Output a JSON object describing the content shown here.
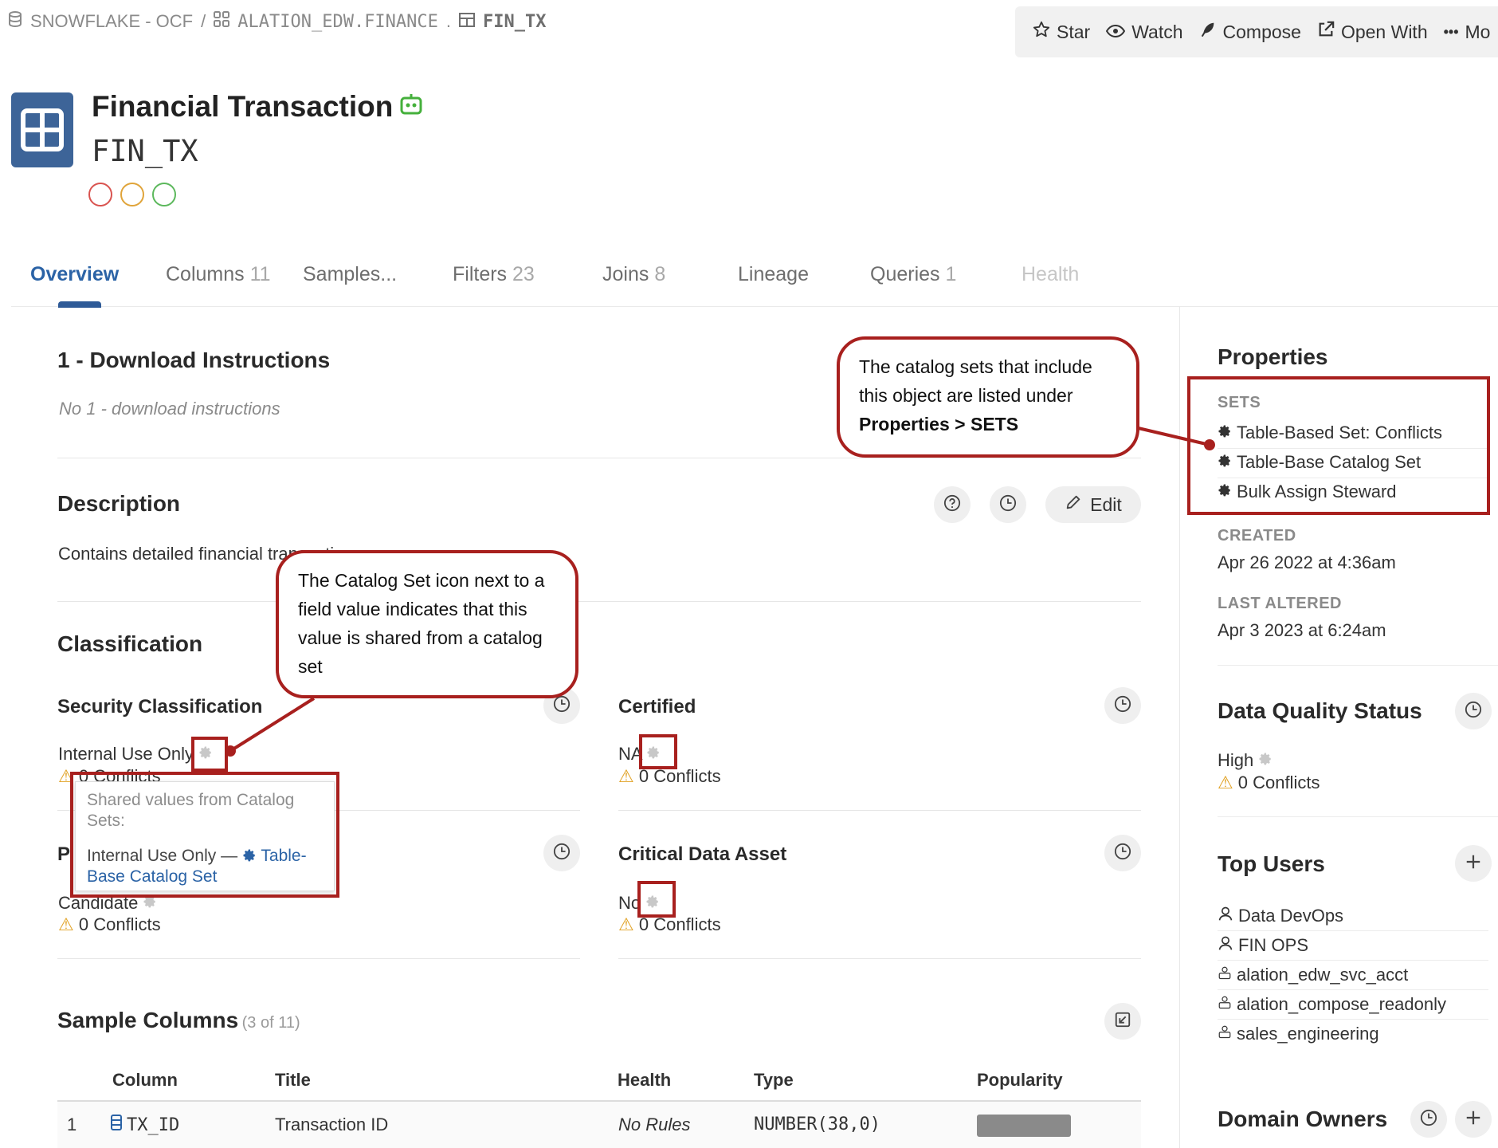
{
  "breadcrumb": {
    "datasource": "SNOWFLAKE - OCF",
    "sep1": "/",
    "schema": "ALATION_EDW.FINANCE",
    "sep2": ".",
    "table": "FIN_TX"
  },
  "toolbar": {
    "star": "Star",
    "watch": "Watch",
    "compose": "Compose",
    "open_with": "Open With",
    "more": "•••",
    "more_clipped": "Mo"
  },
  "header": {
    "title": "Financial Transaction",
    "subtitle": "FIN_TX",
    "circle_colors": [
      "#d9534f",
      "#e0a43a",
      "#5cb85c"
    ]
  },
  "tabs": [
    {
      "label": "Overview",
      "count": ""
    },
    {
      "label": "Columns",
      "count": "11"
    },
    {
      "label": "Samples...",
      "count": ""
    },
    {
      "label": "Filters",
      "count": "23"
    },
    {
      "label": "Joins",
      "count": "8"
    },
    {
      "label": "Lineage",
      "count": ""
    },
    {
      "label": "Queries",
      "count": "1"
    },
    {
      "label": "Health",
      "count": ""
    }
  ],
  "download": {
    "title": "1 - Download Instructions",
    "empty": "No 1 - download instructions"
  },
  "description": {
    "title": "Description",
    "text": "Contains detailed financial transactions",
    "edit": "Edit"
  },
  "classification": {
    "title": "Classification",
    "security": {
      "label": "Security Classification",
      "value": "Internal Use Only",
      "conflicts": "0 Conflicts"
    },
    "certified": {
      "label": "Certified",
      "value": "NA",
      "conflicts": "0 Conflicts"
    },
    "privacy": {
      "label": "P",
      "value": "Candidate",
      "conflicts": "0 Conflicts"
    },
    "critical": {
      "label": "Critical Data Asset",
      "value": "No",
      "conflicts": "0 Conflicts"
    }
  },
  "tooltip": {
    "head": "Shared values from Catalog Sets:",
    "value": "Internal Use Only —",
    "link": "Table-Base Catalog Set"
  },
  "callouts": {
    "top_line1": "The catalog sets that include",
    "top_line2": "this object are listed under",
    "top_bold": "Properties > SETS",
    "mid_line1": "The Catalog Set icon next to a",
    "mid_line2": "field value indicates that this",
    "mid_line3": "value is shared from a catalog",
    "mid_line4": "set"
  },
  "sample_columns": {
    "title": "Sample Columns",
    "count": "(3 of 11)",
    "headers": [
      "Column",
      "Title",
      "Health",
      "Type",
      "Popularity"
    ],
    "rows": [
      {
        "index": "1",
        "column": "TX_ID",
        "title": "Transaction ID",
        "health": "No Rules",
        "type": "NUMBER(38,0)",
        "popularity": 0.6
      }
    ]
  },
  "sidebar": {
    "properties_title": "Properties",
    "sets_label": "SETS",
    "sets": [
      "Table-Based Set: Conflicts",
      "Table-Base Catalog Set",
      "Bulk Assign Steward"
    ],
    "created_label": "CREATED",
    "created_value": "Apr 26 2022 at 4:36am",
    "altered_label": "LAST ALTERED",
    "altered_value": "Apr 3 2023 at 6:24am",
    "dq_title": "Data Quality Status",
    "dq_value": "High",
    "dq_conflicts": "0 Conflicts",
    "top_users_title": "Top Users",
    "top_users": [
      "Data DevOps",
      "FIN OPS",
      "alation_edw_svc_acct",
      "alation_compose_readonly",
      "sales_engineering"
    ],
    "domain_owners_title": "Domain Owners"
  }
}
